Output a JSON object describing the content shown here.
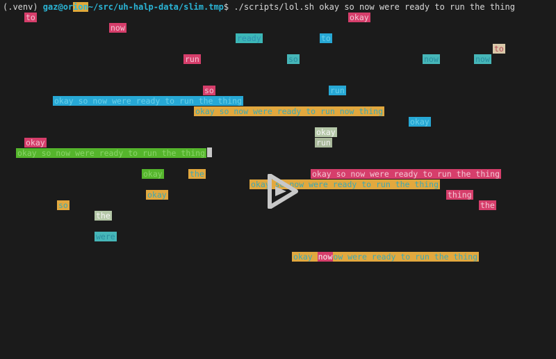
{
  "prompt": {
    "venv": "(.venv) ",
    "user": "gaz@or",
    "host_tail": "ion",
    "path": "~/src/uh-halp-data/slim.tmp",
    "symbol": "$ ",
    "command": "./scripts/lol.sh okay so now were ready to run the thing"
  },
  "words": [
    {
      "text": "to",
      "color": "pink"
    },
    {
      "text": "okay",
      "color": "pink"
    },
    {
      "text": "now",
      "color": "pink"
    },
    {
      "text": "ready",
      "color": "cyan"
    },
    {
      "text": "to",
      "color": "blue"
    },
    {
      "text": "to",
      "color": "beige"
    },
    {
      "text": "run",
      "color": "pink"
    },
    {
      "text": "so",
      "color": "teal"
    },
    {
      "text": "now",
      "color": "teal"
    },
    {
      "text": "now",
      "color": "teal"
    },
    {
      "text": "so",
      "color": "pink"
    },
    {
      "text": "run",
      "color": "blue"
    },
    {
      "text": "okay so now were ready to run the thing",
      "color": "blue"
    },
    {
      "text": "okay so now were ready to run now thing",
      "color": "yellow"
    },
    {
      "text": "okay",
      "color": "blue"
    },
    {
      "text": "okay",
      "color": "lightg"
    },
    {
      "text": "run",
      "color": "greyg"
    },
    {
      "text": "okay",
      "color": "pink"
    },
    {
      "text": "okay so now were ready to run the thing",
      "color": "green"
    },
    {
      "text": "okay",
      "color": "green"
    },
    {
      "text": "the",
      "color": "yellow"
    },
    {
      "text": "okay so now were ready to run the thing",
      "color": "pink"
    },
    {
      "text": "okay so now were ready to run the thing",
      "color": "yellow"
    },
    {
      "text": "okay",
      "color": "yellow"
    },
    {
      "text": "thing",
      "color": "pink"
    },
    {
      "text": "so",
      "color": "yellow"
    },
    {
      "text": "the",
      "color": "pink"
    },
    {
      "text": "the",
      "color": "lightg"
    },
    {
      "text": "were",
      "color": "teal"
    },
    {
      "text": "okay ",
      "color": "yellow"
    }
  ],
  "last_line_highlight": "now",
  "last_line_tail": "ow were ready to run the thing",
  "icons": {
    "play": "play-icon"
  }
}
